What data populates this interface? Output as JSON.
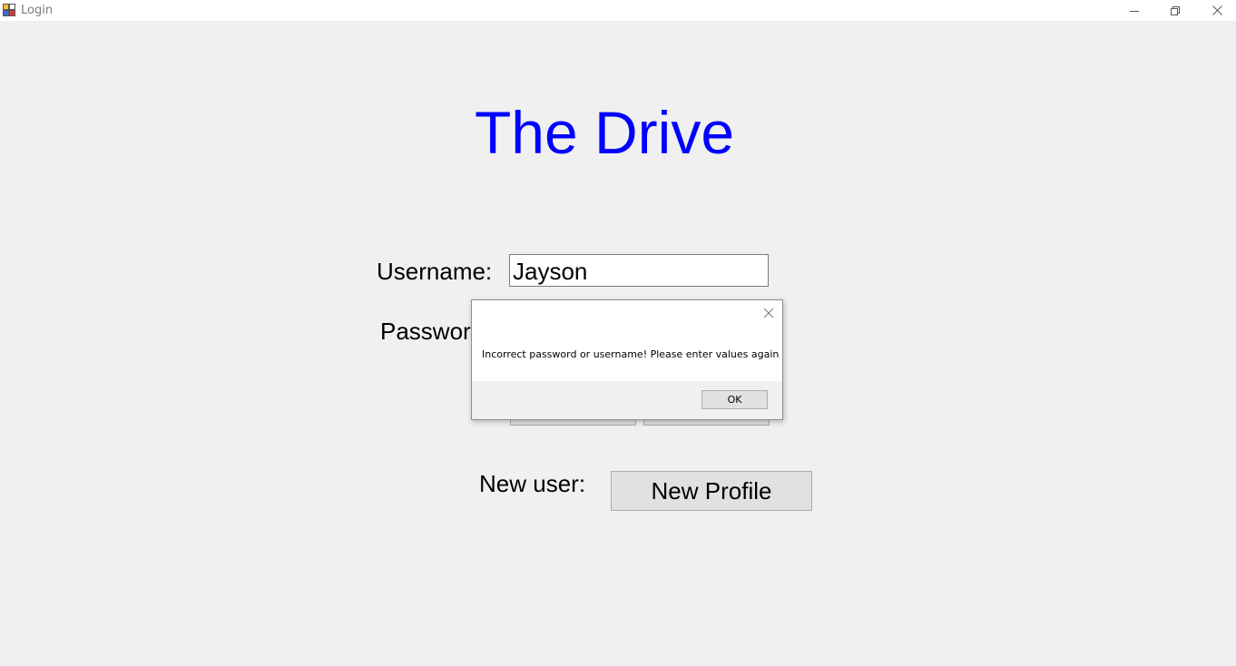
{
  "window": {
    "title": "Login",
    "icons": [
      "app-icon",
      "minimize-icon",
      "restore-icon",
      "close-icon"
    ]
  },
  "main": {
    "app_title": "The Drive",
    "username_label": "Username:",
    "username_value": "Jayson",
    "password_label": "Passwor",
    "new_user_label": "New user:",
    "new_profile_button": "New Profile"
  },
  "dialog": {
    "message": "Incorrect password or username! Please enter values again",
    "ok_button": "OK"
  },
  "colors": {
    "title_color": "#0000ff",
    "background": "#f0f0f0"
  }
}
